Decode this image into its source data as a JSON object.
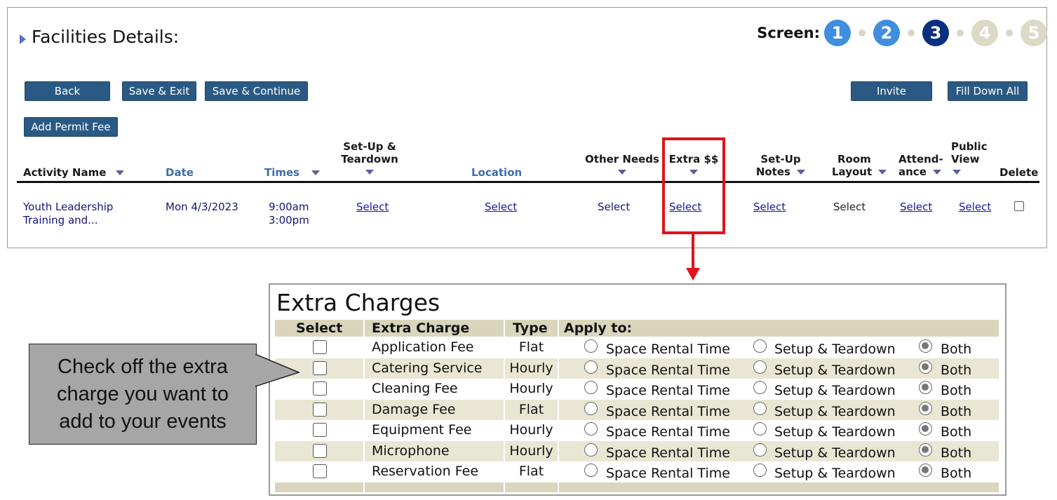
{
  "page": {
    "title": "Facilities Details:",
    "screen_label": "Screen:",
    "steps": [
      "1",
      "2",
      "3",
      "4",
      "5"
    ],
    "current_step": 3
  },
  "buttons": {
    "back": "Back",
    "save_exit": "Save & Exit",
    "save_continue": "Save & Continue",
    "invite": "Invite",
    "fill_down_all": "Fill Down All",
    "add_permit_fee": "Add Permit Fee"
  },
  "table": {
    "headers": {
      "activity_name": "Activity Name",
      "date": "Date",
      "times": "Times",
      "setup_line1": "Set-Up &",
      "setup_line2": "Teardown",
      "location": "Location",
      "other_needs": "Other Needs",
      "extra": "Extra $$",
      "setup_notes_line1": "Set-Up",
      "setup_notes_line2": "Notes",
      "room_layout_line1": "Room",
      "room_layout_line2": "Layout",
      "attendance_line1": "Attend-",
      "attendance_line2": "ance",
      "public_view_line1": "Public",
      "public_view_line2": "View",
      "delete": "Delete"
    },
    "row": {
      "activity_line1": "Youth Leadership",
      "activity_line2": "Training and...",
      "date": "Mon 4/3/2023",
      "time_start": "9:00am",
      "time_end": "3:00pm",
      "setup_teardown": "Select",
      "location": "Select",
      "other_needs": "Select",
      "extra": "Select",
      "setup_notes": "Select",
      "room_layout": "Select",
      "attendance": "Select",
      "public_view": "Select",
      "delete_checked": false
    }
  },
  "extra_charges": {
    "title": "Extra Charges",
    "headers": {
      "select": "Select",
      "extra_charge": "Extra Charge",
      "type": "Type",
      "apply_to": "Apply to:"
    },
    "apply_options": [
      "Space Rental Time",
      "Setup & Teardown",
      "Both"
    ],
    "rows": [
      {
        "name": "Application Fee",
        "type": "Flat",
        "checked": false,
        "apply": "Both"
      },
      {
        "name": "Catering Service",
        "type": "Hourly",
        "checked": false,
        "apply": "Both"
      },
      {
        "name": "Cleaning Fee",
        "type": "Hourly",
        "checked": false,
        "apply": "Both"
      },
      {
        "name": "Damage Fee",
        "type": "Flat",
        "checked": false,
        "apply": "Both"
      },
      {
        "name": "Equipment Fee",
        "type": "Hourly",
        "checked": false,
        "apply": "Both"
      },
      {
        "name": "Microphone",
        "type": "Hourly",
        "checked": false,
        "apply": "Both"
      },
      {
        "name": "Reservation Fee",
        "type": "Flat",
        "checked": false,
        "apply": "Both"
      }
    ]
  },
  "callout": {
    "line1": "Check off the extra",
    "line2": "charge you want to",
    "line3": "add to your events"
  },
  "colors": {
    "button": "#2a5a83",
    "highlight": "#e0141a",
    "step_done": "#3f8ee0",
    "step_current": "#0b2f7f",
    "step_todo": "#dcd9c6"
  }
}
